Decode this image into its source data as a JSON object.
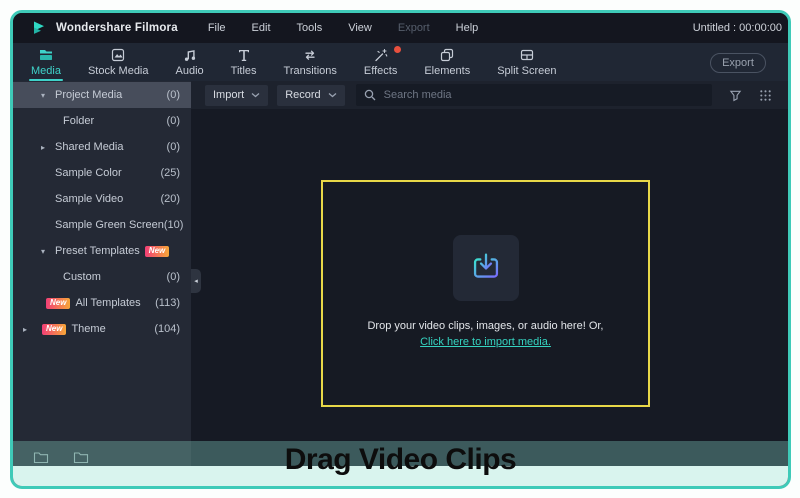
{
  "menubar": {
    "app_title": "Wondershare Filmora",
    "items": [
      {
        "label": "File",
        "disabled": false
      },
      {
        "label": "Edit",
        "disabled": false
      },
      {
        "label": "Tools",
        "disabled": false
      },
      {
        "label": "View",
        "disabled": false
      },
      {
        "label": "Export",
        "disabled": true
      },
      {
        "label": "Help",
        "disabled": false
      }
    ],
    "project_title": "Untitled : 00:00:00"
  },
  "tabs": [
    {
      "label": "Media",
      "active": true,
      "notification": false
    },
    {
      "label": "Stock Media",
      "active": false,
      "notification": false
    },
    {
      "label": "Audio",
      "active": false,
      "notification": false
    },
    {
      "label": "Titles",
      "active": false,
      "notification": false
    },
    {
      "label": "Transitions",
      "active": false,
      "notification": false
    },
    {
      "label": "Effects",
      "active": false,
      "notification": true
    },
    {
      "label": "Elements",
      "active": false,
      "notification": false
    },
    {
      "label": "Split Screen",
      "active": false,
      "notification": false
    }
  ],
  "export_button": {
    "label": "Export"
  },
  "toolbar": {
    "import_label": "Import",
    "record_label": "Record",
    "search_placeholder": "Search media"
  },
  "sidebar": {
    "items": [
      {
        "label": "Project Media",
        "count": "(0)",
        "arrow": "▾",
        "indent": 1,
        "selected": true,
        "badge": null,
        "badge_position": null
      },
      {
        "label": "Folder",
        "count": "(0)",
        "arrow": null,
        "indent": 2,
        "selected": false,
        "badge": null,
        "badge_position": null
      },
      {
        "label": "Shared Media",
        "count": "(0)",
        "arrow": "▸",
        "indent": 1,
        "selected": false,
        "badge": null,
        "badge_position": null
      },
      {
        "label": "Sample Color",
        "count": "(25)",
        "arrow": null,
        "indent": 1,
        "selected": false,
        "badge": null,
        "badge_position": null
      },
      {
        "label": "Sample Video",
        "count": "(20)",
        "arrow": null,
        "indent": 1,
        "selected": false,
        "badge": null,
        "badge_position": null
      },
      {
        "label": "Sample Green Screen",
        "count": "(10)",
        "arrow": null,
        "indent": 1,
        "selected": false,
        "badge": null,
        "badge_position": null
      },
      {
        "label": "Preset Templates",
        "count": "",
        "arrow": "▾",
        "indent": 1,
        "selected": false,
        "badge": "New",
        "badge_position": "after"
      },
      {
        "label": "Custom",
        "count": "(0)",
        "arrow": null,
        "indent": 2,
        "selected": false,
        "badge": null,
        "badge_position": null
      },
      {
        "label": "All Templates",
        "count": "(113)",
        "arrow": null,
        "indent": 1,
        "selected": false,
        "badge": "New",
        "badge_position": "before"
      },
      {
        "label": "Theme",
        "count": "(104)",
        "arrow": "▸",
        "indent": 0,
        "selected": false,
        "badge": "New",
        "badge_position": "before"
      }
    ]
  },
  "dropzone": {
    "line1": "Drop your video clips, images, or audio here! Or,",
    "link": "Click here to import media."
  },
  "caption": {
    "text": "Drag Video Clips"
  },
  "colors": {
    "frame_border": "#3fcab8",
    "accent_teal": "#3fd2c9",
    "dropzone_border": "#e8d848",
    "notification_dot": "#e8503e",
    "badge_gradient_start": "#f23f77",
    "badge_gradient_end": "#f7a738",
    "caption_dark_band": "#3c5a5c",
    "caption_light_band": "#d9f4ee"
  }
}
